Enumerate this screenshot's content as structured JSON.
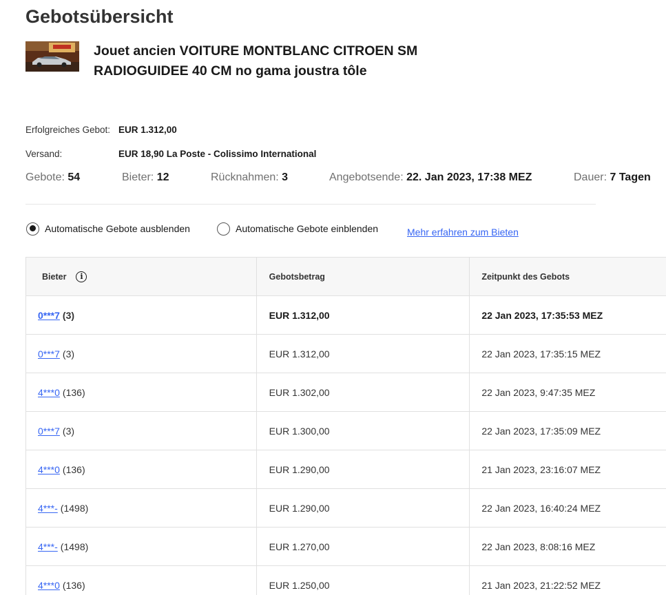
{
  "page": {
    "title": "Gebotsübersicht"
  },
  "item": {
    "title_line1": "Jouet ancien VOITURE MONTBLANC CITROEN SM",
    "title_line2": "RADIOGUIDEE 40 CM no gama joustra tôle"
  },
  "summary": {
    "winning_bid_label": "Erfolgreiches Gebot:",
    "winning_bid_value": "EUR 1.312,00",
    "shipping_label": "Versand:",
    "shipping_value": "EUR 18,90 La Poste - Colissimo International"
  },
  "stats": {
    "bids_label": "Gebote:",
    "bids_value": "54",
    "bidders_label": "Bieter:",
    "bidders_value": "12",
    "retractions_label": "Rücknahmen:",
    "retractions_value": "3",
    "end_label": "Angebotsende:",
    "end_value": "22. Jan 2023, 17:38 MEZ",
    "duration_label": "Dauer:",
    "duration_value": "7 Tagen"
  },
  "options": {
    "hide_auto_label": "Automatische Gebote ausblenden",
    "hide_auto_selected": true,
    "show_auto_label": "Automatische Gebote einblenden",
    "learn_more_link": "Mehr erfahren zum Bieten"
  },
  "table": {
    "headers": {
      "bidder": "Bieter",
      "amount": "Gebotsbetrag",
      "time": "Zeitpunkt des Gebots"
    },
    "rows": [
      {
        "bidder": "0***7",
        "feedback": "(3)",
        "amount": "EUR 1.312,00",
        "time": "22 Jan 2023, 17:35:53 MEZ",
        "winning": true
      },
      {
        "bidder": "0***7",
        "feedback": "(3)",
        "amount": "EUR 1.312,00",
        "time": "22 Jan 2023, 17:35:15 MEZ"
      },
      {
        "bidder": "4***0",
        "feedback": "(136)",
        "amount": "EUR 1.302,00",
        "time": "22 Jan 2023, 9:47:35 MEZ"
      },
      {
        "bidder": "0***7",
        "feedback": "(3)",
        "amount": "EUR 1.300,00",
        "time": "22 Jan 2023, 17:35:09 MEZ"
      },
      {
        "bidder": "4***0",
        "feedback": "(136)",
        "amount": "EUR 1.290,00",
        "time": "21 Jan 2023, 23:16:07 MEZ"
      },
      {
        "bidder": "4***-",
        "feedback": "(1498)",
        "amount": "EUR 1.290,00",
        "time": "22 Jan 2023, 16:40:24 MEZ"
      },
      {
        "bidder": "4***-",
        "feedback": "(1498)",
        "amount": "EUR 1.270,00",
        "time": "22 Jan 2023, 8:08:16 MEZ"
      },
      {
        "bidder": "4***0",
        "feedback": "(136)",
        "amount": "EUR 1.250,00",
        "time": "21 Jan 2023, 21:22:52 MEZ"
      }
    ]
  }
}
